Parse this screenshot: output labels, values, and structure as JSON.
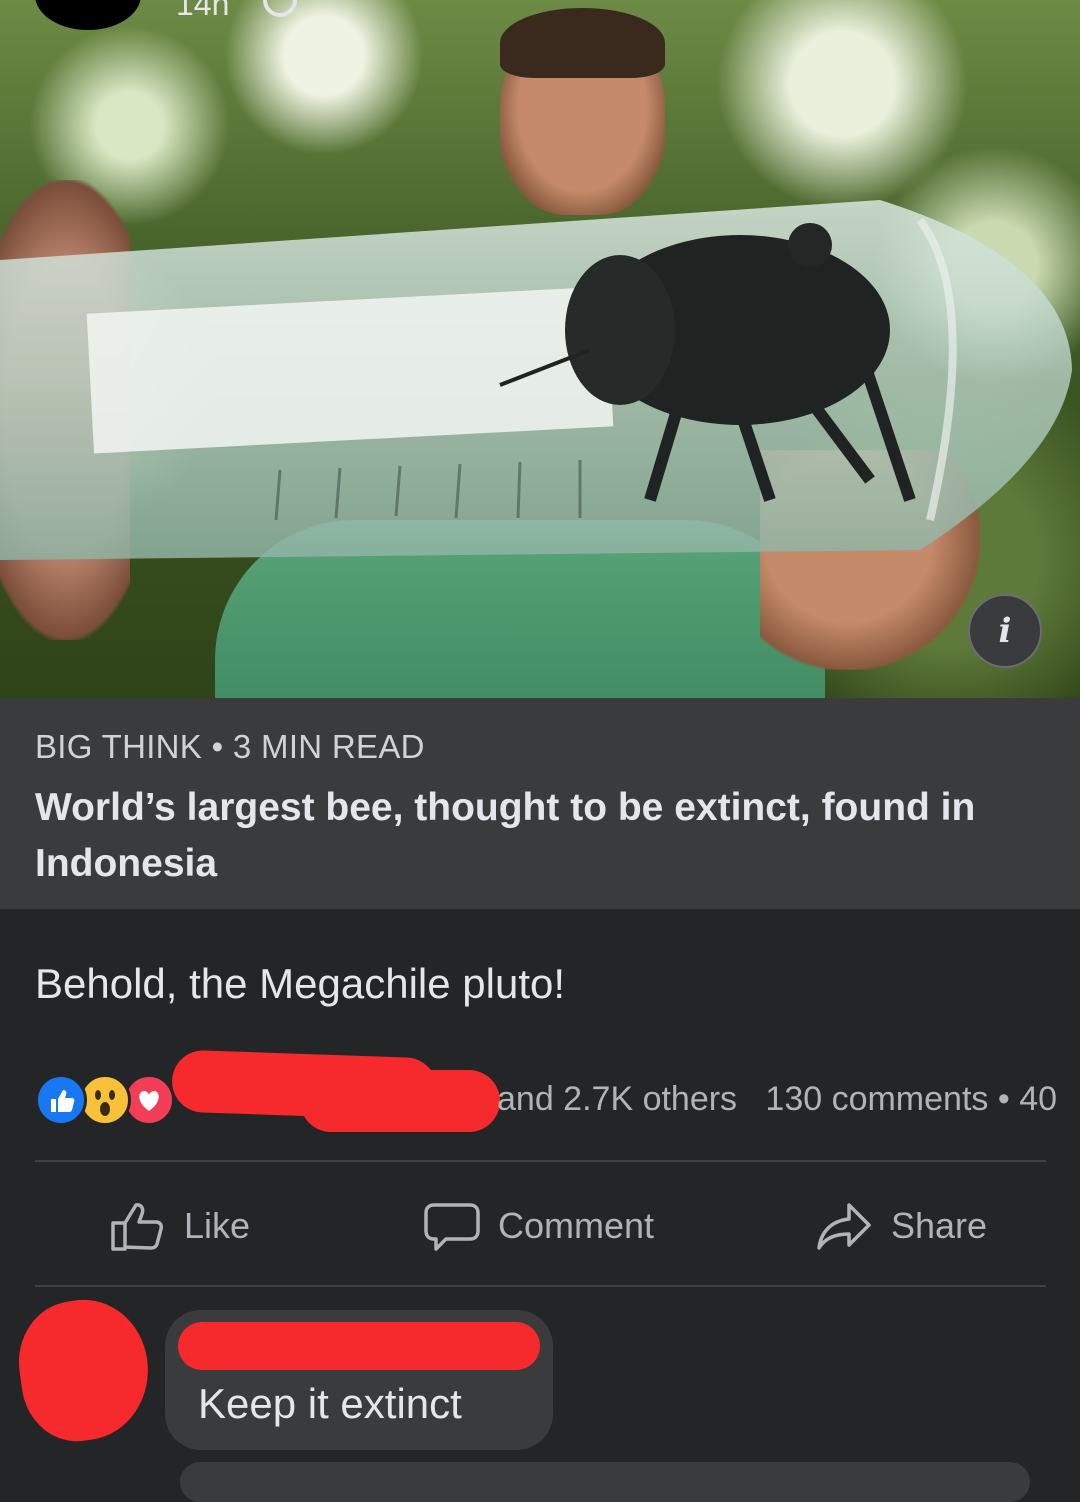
{
  "post_header": {
    "time": "14h"
  },
  "link_preview": {
    "source": "BIG THINK",
    "separator": "•",
    "read_time": "3 MIN READ",
    "title": "World’s largest bee, thought to be extinct, found in Indonesia"
  },
  "post": {
    "text": "Behold, the Megachile pluto!"
  },
  "reactions": {
    "icons": [
      "like-icon",
      "wow-icon",
      "love-icon"
    ],
    "summary_text": "and 2.7K others",
    "comments": "130 comments",
    "separator": "•",
    "shares_partial": "40"
  },
  "actions": {
    "like": "Like",
    "comment": "Comment",
    "share": "Share"
  },
  "comment": {
    "text": "Keep it extinct"
  },
  "colors": {
    "background": "#242526",
    "card": "#3a3b3c",
    "text_primary": "#e4e6eb",
    "text_secondary": "#b0b3b8",
    "like_blue": "#1877f2",
    "love_red": "#f33e58",
    "wow_yellow": "#f7c238",
    "redaction": "#f6292c"
  }
}
